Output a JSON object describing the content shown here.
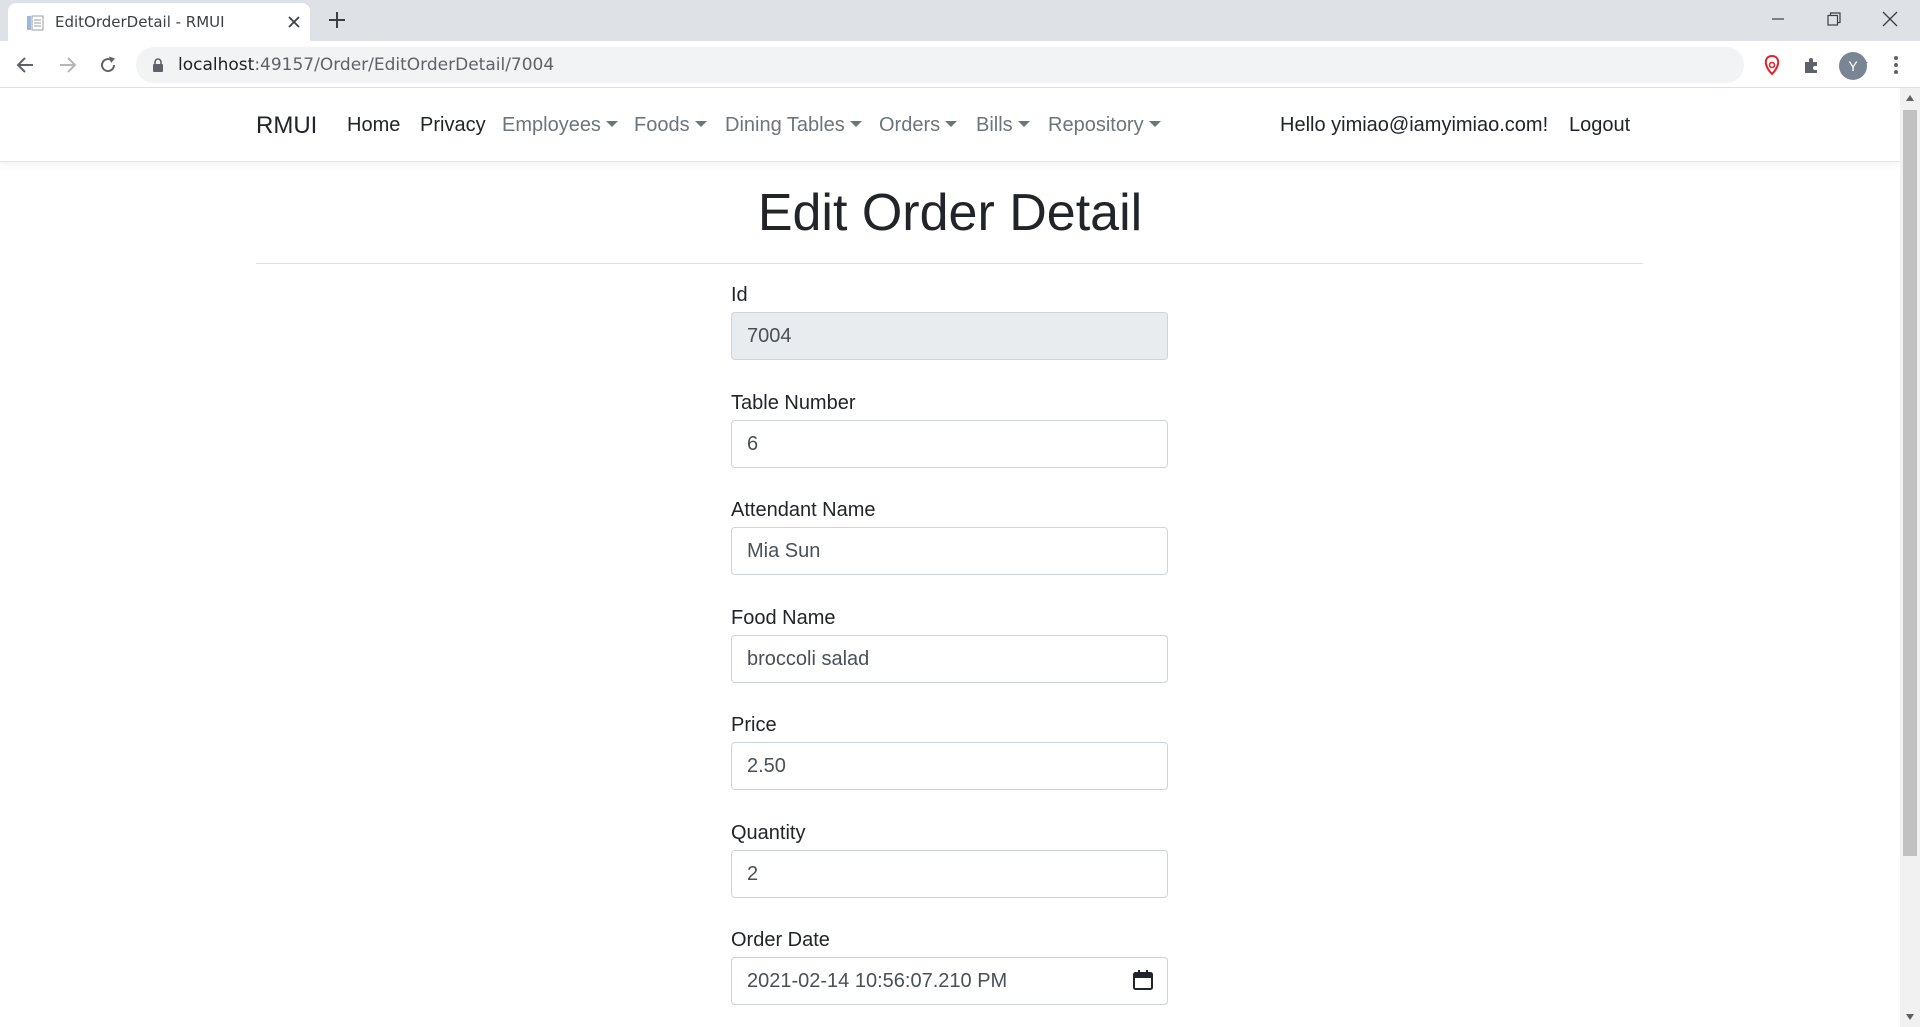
{
  "browser": {
    "tab_title": "EditOrderDetail - RMUI",
    "url_host": "localhost",
    "url_path": ":49157/Order/EditOrderDetail/7004",
    "avatar_initial": "Y"
  },
  "navbar": {
    "brand": "RMUI",
    "links": {
      "home": "Home",
      "privacy": "Privacy",
      "employees": "Employees",
      "foods": "Foods",
      "dining_tables": "Dining Tables",
      "orders": "Orders",
      "bills": "Bills",
      "repository": "Repository"
    },
    "greeting": "Hello yimiao@iamyimiao.com!",
    "logout": "Logout"
  },
  "page": {
    "title": "Edit Order Detail"
  },
  "form": {
    "id": {
      "label": "Id",
      "value": "7004"
    },
    "table_number": {
      "label": "Table Number",
      "value": "6"
    },
    "attendant_name": {
      "label": "Attendant Name",
      "value": "Mia Sun"
    },
    "food_name": {
      "label": "Food Name",
      "value": "broccoli salad"
    },
    "price": {
      "label": "Price",
      "value": "2.50"
    },
    "quantity": {
      "label": "Quantity",
      "value": "2"
    },
    "order_date": {
      "label": "Order Date",
      "value": "2021-02-14 10:56:07.210 PM"
    }
  }
}
